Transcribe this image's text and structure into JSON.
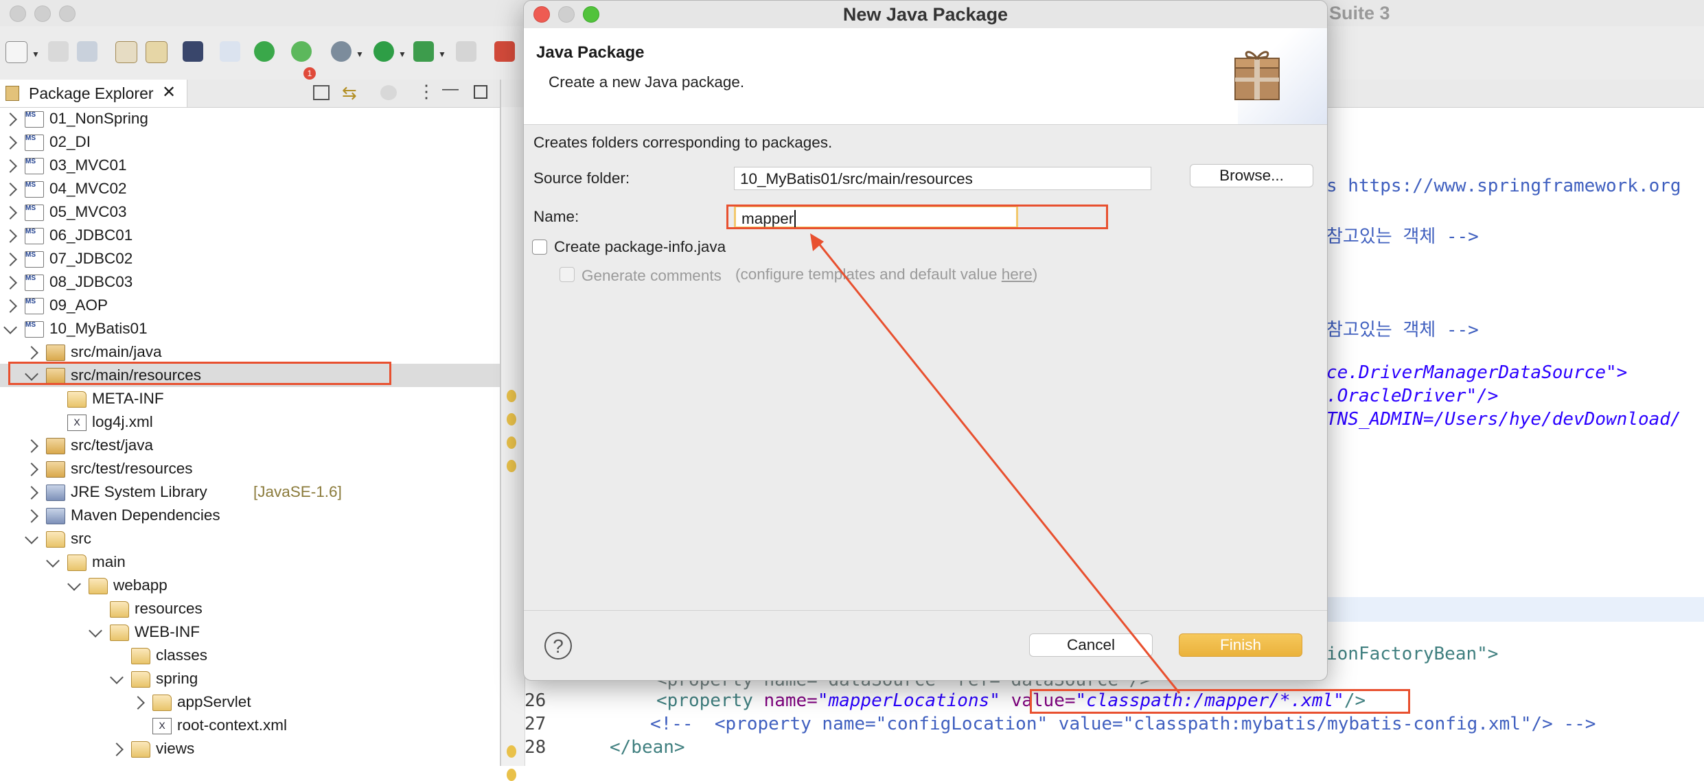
{
  "window": {
    "background_title": "Suite 3"
  },
  "explorer": {
    "tab_label": "Package Explorer",
    "rows": [
      {
        "label": "01_NonSpring"
      },
      {
        "label": "02_DI"
      },
      {
        "label": "03_MVC01"
      },
      {
        "label": "04_MVC02"
      },
      {
        "label": "05_MVC03"
      },
      {
        "label": "06_JDBC01"
      },
      {
        "label": "07_JDBC02"
      },
      {
        "label": "08_JDBC03"
      },
      {
        "label": "09_AOP"
      },
      {
        "label": "10_MyBatis01"
      },
      {
        "label": "src/main/java"
      },
      {
        "label": "src/main/resources"
      },
      {
        "label": "META-INF"
      },
      {
        "label": "log4j.xml"
      },
      {
        "label": "src/test/java"
      },
      {
        "label": "src/test/resources"
      },
      {
        "label": "JRE System Library",
        "suffix": "[JavaSE-1.6]"
      },
      {
        "label": "Maven Dependencies"
      },
      {
        "label": "src"
      },
      {
        "label": "main"
      },
      {
        "label": "webapp"
      },
      {
        "label": "resources"
      },
      {
        "label": "WEB-INF"
      },
      {
        "label": "classes"
      },
      {
        "label": "spring"
      },
      {
        "label": "appServlet"
      },
      {
        "label": "root-context.xml"
      },
      {
        "label": "views"
      }
    ]
  },
  "editor": {
    "fragments": {
      "f1": "s https://www.springframework.org",
      "f2": "참고있는 객체 -->",
      "f3": "참고있는 객체 -->",
      "f4": "ce.DriverManagerDataSource\">",
      "f5": ".OracleDriver\"/>",
      "f6": "TNS_ADMIN=/Users/hye/devDownload/",
      "f7": "ionFactoryBean\">"
    },
    "lines": [
      {
        "num": "26",
        "indent": "    ",
        "tag": "<property",
        "attr1": " name=",
        "val1": "\"mapperLocations\"",
        "attr2": " value=",
        "val2": "\"classpath:/mapper/*.xml\"",
        "end": "/>"
      },
      {
        "num": "27",
        "text": "   <!--  <property name=\"configLocation\" value=\"classpath:mybatis/mybatis-config.xml\"/> -->"
      },
      {
        "num": "28",
        "text": "</bean>"
      }
    ],
    "partial_line_25": "<property name=\"dataSource\" ref=\"dataSource\"/>"
  },
  "dialog": {
    "title": "New Java Package",
    "header_title": "Java Package",
    "header_desc": "Create a new Java package.",
    "info": "Creates folders corresponding to packages.",
    "source_folder_label": "Source folder:",
    "source_folder_value": "10_MyBatis01/src/main/resources",
    "browse_label": "Browse...",
    "name_label": "Name:",
    "name_value": "mapper",
    "create_pkg_info_label": "Create package-info.java",
    "generate_comments_label": "Generate comments",
    "configure_note_prefix": "(configure templates and default value ",
    "configure_link": "here",
    "configure_note_suffix": ")",
    "cancel_label": "Cancel",
    "finish_label": "Finish",
    "help_icon": "?"
  },
  "colors": {
    "annotation_red": "#e8502f",
    "finish_yellow": "#eab23b"
  }
}
